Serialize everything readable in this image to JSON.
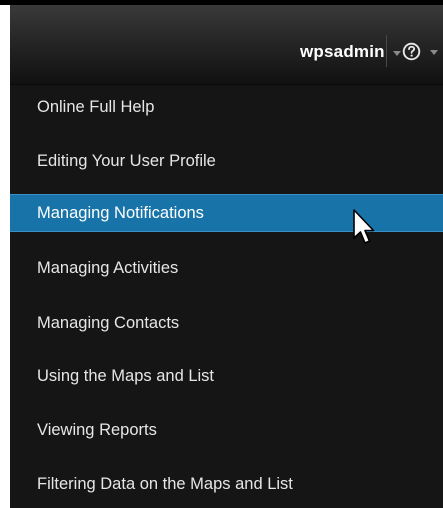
{
  "header": {
    "username": "wpsadmin",
    "user_menu_caret_icon": "chevron-down-icon",
    "help_icon": "question-circle-icon",
    "help_menu_caret_icon": "chevron-down-icon"
  },
  "help_menu": {
    "items": [
      {
        "label": "Online Full Help",
        "active": false
      },
      {
        "label": "Editing Your User Profile",
        "active": false
      },
      {
        "label": "Managing Notifications",
        "active": true
      },
      {
        "label": "Managing Activities",
        "active": false
      },
      {
        "label": "Managing Contacts",
        "active": false
      },
      {
        "label": "Using the Maps and List",
        "active": false
      },
      {
        "label": "Viewing Reports",
        "active": false
      },
      {
        "label": "Filtering Data on the Maps and List",
        "active": false
      }
    ]
  },
  "colors": {
    "header_bg": "#262626",
    "menu_bg": "#151515",
    "highlight": "#1874a8",
    "text": "#e6e6e6"
  },
  "cursor_icon": "mouse-pointer-icon"
}
